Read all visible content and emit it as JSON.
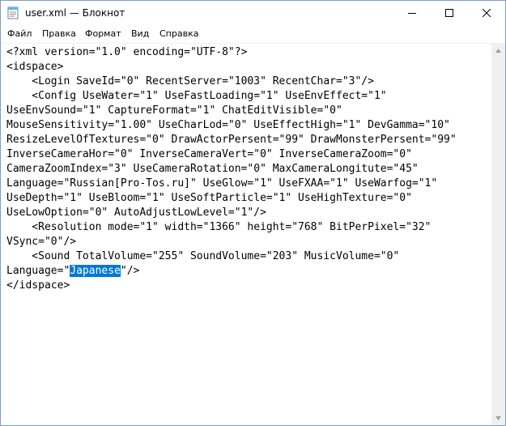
{
  "window": {
    "title": "user.xml — Блокнот"
  },
  "menu": {
    "file": "Файл",
    "edit": "Правка",
    "format": "Формат",
    "view": "Вид",
    "help": "Справка"
  },
  "editor": {
    "lines": [
      "<?xml version=\"1.0\" encoding=\"UTF-8\"?>",
      "<idspace>",
      "    <Login SaveId=\"0\" RecentServer=\"1003\" RecentChar=\"3\"/>",
      "    <Config UseWater=\"1\" UseFastLoading=\"1\" UseEnvEffect=\"1\"",
      "UseEnvSound=\"1\" CaptureFormat=\"1\" ChatEditVisible=\"0\"",
      "MouseSensitivity=\"1.00\" UseCharLod=\"0\" UseEffectHigh=\"1\" DevGamma=\"10\"",
      "ResizeLevelOfTextures=\"0\" DrawActorPersent=\"99\" DrawMonsterPersent=\"99\"",
      "InverseCameraHor=\"0\" InverseCameraVert=\"0\" InverseCameraZoom=\"0\"",
      "CameraZoomIndex=\"3\" UseCameraRotation=\"0\" MaxCameraLongitute=\"45\"",
      "Language=\"Russian[Pro-Tos.ru]\" UseGlow=\"1\" UseFXAA=\"1\" UseWarfog=\"1\"",
      "UseDepth=\"1\" UseBloom=\"1\" UseSoftParticle=\"1\" UseHighTexture=\"0\"",
      "UseLowOption=\"0\" AutoAdjustLowLevel=\"1\"/>",
      "    <Resolution mode=\"1\" width=\"1366\" height=\"768\" BitPerPixel=\"32\"",
      "VSync=\"0\"/>",
      "    <Sound TotalVolume=\"255\" SoundVolume=\"203\" MusicVolume=\"0\""
    ],
    "line15_before": "Language=\"",
    "line15_selected": "Japanese",
    "line15_after": "\"/>",
    "line16": "</idspace>"
  },
  "colors": {
    "selection": "#0078d7",
    "border": "#7a9cc6"
  }
}
